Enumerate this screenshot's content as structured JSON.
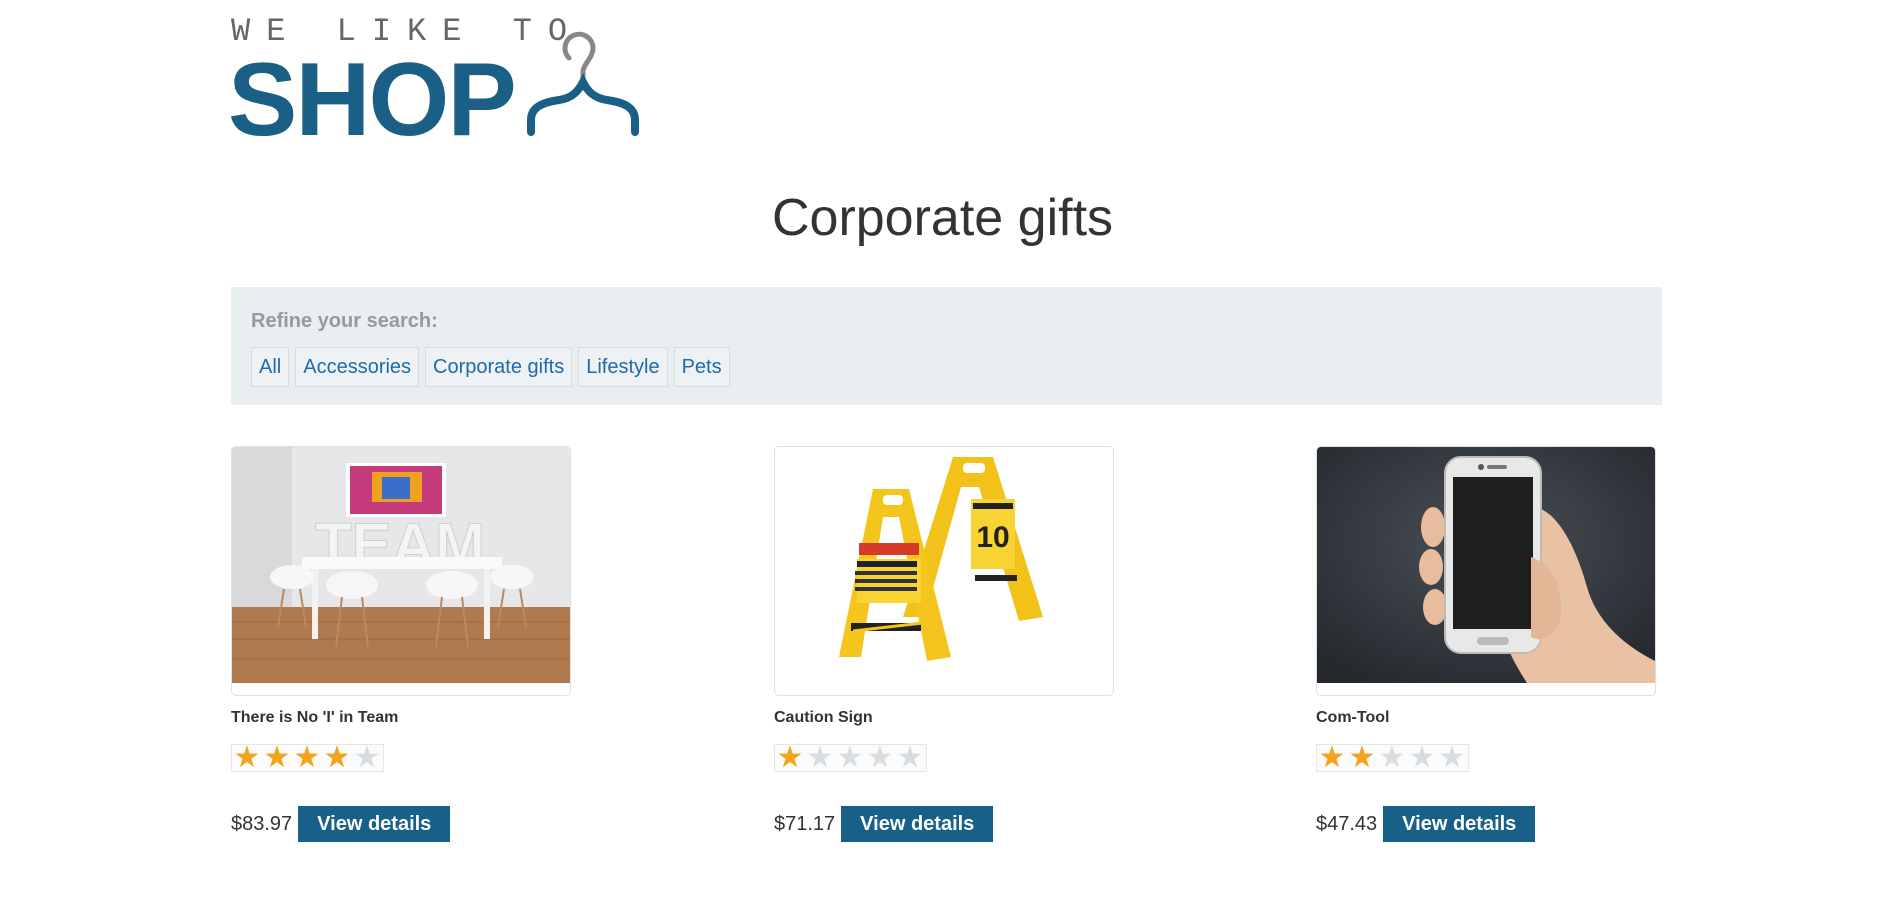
{
  "logo": {
    "tagline": "WE LIKE TO",
    "brand": "SHOP",
    "brand_color": "#1a5f85"
  },
  "page": {
    "title": "Corporate gifts"
  },
  "filter": {
    "label": "Refine your search:",
    "links": [
      "All",
      "Accessories",
      "Corporate gifts",
      "Lifestyle",
      "Pets"
    ]
  },
  "products": [
    {
      "name": "There is No 'I' in Team",
      "rating": 4,
      "max_rating": 5,
      "price": "$83.97",
      "button": "View details",
      "image": "team-room-image"
    },
    {
      "name": "Caution Sign",
      "rating": 1,
      "max_rating": 5,
      "price": "$71.17",
      "button": "View details",
      "image": "caution-sign-image"
    },
    {
      "name": "Com-Tool",
      "rating": 2,
      "max_rating": 5,
      "price": "$47.43",
      "button": "View details",
      "image": "phone-in-hand-image"
    }
  ],
  "colors": {
    "accent": "#17608a",
    "star_on": "#f4a31a",
    "star_off": "#d7dee3",
    "panel": "#e9eef1"
  },
  "image_text": {
    "team_word": "TEAM"
  }
}
